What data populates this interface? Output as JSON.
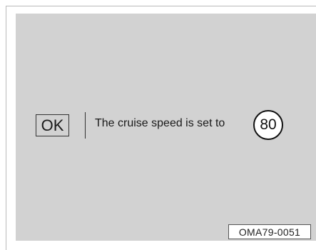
{
  "display": {
    "ok_label": "OK",
    "message": "The cruise speed is set to",
    "speed_value": "80"
  },
  "figure_code": "OMA79-0051",
  "colors": {
    "panel_background": "#d2d2d2",
    "text": "#1a1a1a"
  }
}
